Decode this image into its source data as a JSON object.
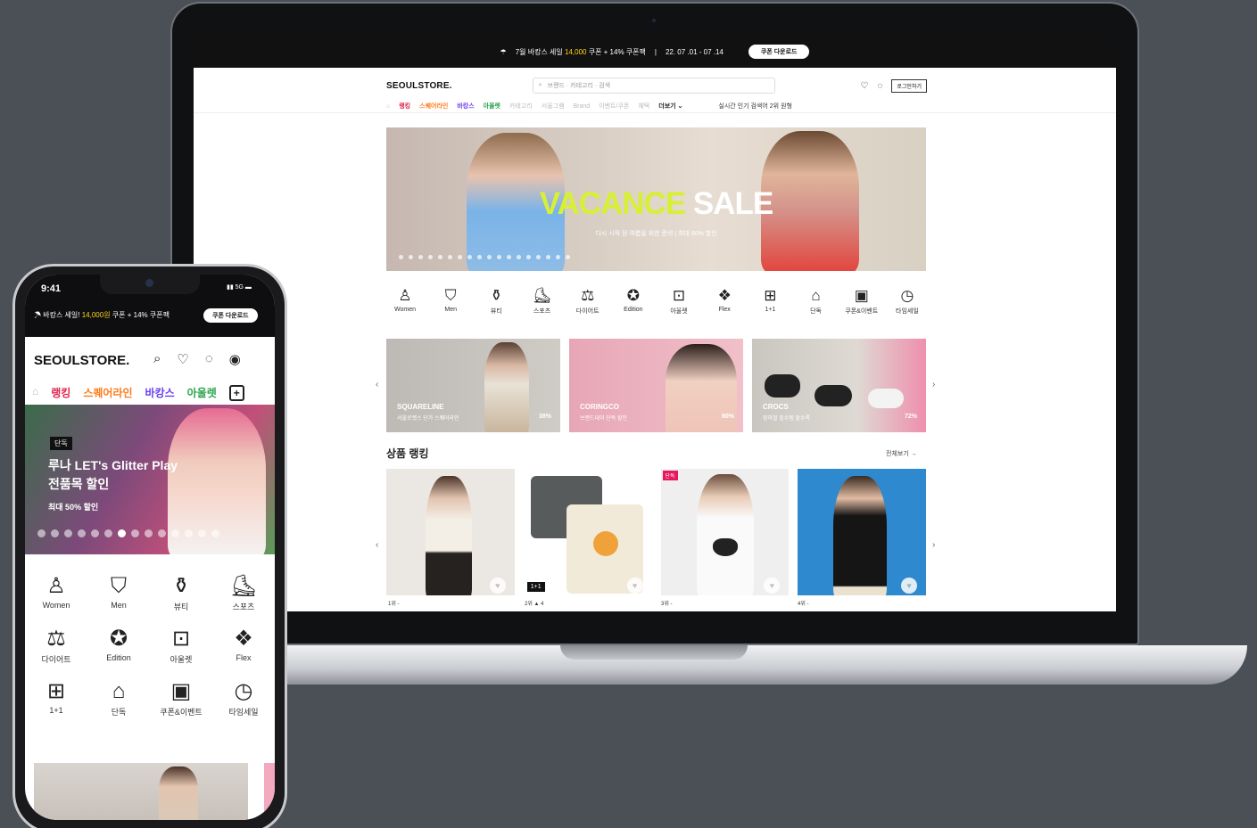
{
  "desktop": {
    "promo": {
      "text_a": "7월 바캉스 세일",
      "amount": "14,000",
      "text_b": "쿠폰 + 14% 쿠폰팩",
      "date": "22. 07 .01 - 07 .14",
      "button": "쿠폰 다운로드"
    },
    "header": {
      "logo": "SEOULSTORE.",
      "search_placeholder": "브랜드 · 카테고리 · 검색",
      "login": "로그인하기"
    },
    "nav": {
      "items": [
        "랭킹",
        "스퀘어라인",
        "바캉스",
        "아울렛",
        "카테고리",
        "서울그램",
        "Brand",
        "이벤트/쿠폰",
        "혜택"
      ],
      "more": "더보기 ⌄",
      "realtime": "실시간 인기 검색어 2위 원형",
      "colors": [
        "#e0224d",
        "#ff7b1c",
        "#6a3df0",
        "#27a34b"
      ]
    },
    "banner": {
      "title_a": "VACANCE",
      "title_b": "SALE",
      "subtitle": "다시 시작 된 여름을 위한 준비 | 최대 80% 할인"
    },
    "categories": [
      {
        "label": "Women",
        "icon": "dress-icon"
      },
      {
        "label": "Men",
        "icon": "jacket-icon"
      },
      {
        "label": "뷰티",
        "icon": "cosmetics-icon"
      },
      {
        "label": "스포츠",
        "icon": "sneaker-icon"
      },
      {
        "label": "다이어트",
        "icon": "scale-icon"
      },
      {
        "label": "Edition",
        "icon": "badge-percent-icon"
      },
      {
        "label": "아울렛",
        "icon": "bag-icon"
      },
      {
        "label": "Flex",
        "icon": "flex-icon"
      },
      {
        "label": "1+1",
        "icon": "plus-box-icon"
      },
      {
        "label": "단독",
        "icon": "tag-icon"
      },
      {
        "label": "쿠폰&이벤트",
        "icon": "coupon-icon"
      },
      {
        "label": "타임세일",
        "icon": "clock-icon"
      }
    ],
    "brands": [
      {
        "name": "SQUARELINE",
        "sub": "서울로켓스 단가 스퀘어라인",
        "pct": "38%"
      },
      {
        "name": "CORINGCO",
        "sub": "브랜드데이 단독 할인",
        "pct": "80%"
      },
      {
        "name": "CROCS",
        "sub": "장마철 필수템 할수록",
        "pct": "72%"
      }
    ],
    "ranking": {
      "title": "상품 랭킹",
      "more": "전체보기 →",
      "items": [
        {
          "rank": "1위  -",
          "tag": "",
          "badge": ""
        },
        {
          "rank": "2위  ▲ 4",
          "tag": "",
          "badge": "1+1"
        },
        {
          "rank": "3위  -",
          "tag": "단독",
          "badge": ""
        },
        {
          "rank": "4위  -",
          "tag": "",
          "badge": ""
        }
      ]
    }
  },
  "mobile": {
    "status": {
      "time": "9:41",
      "signal": "▮▮ 5G ▬"
    },
    "promo": {
      "text_a": "바캉스 세일!",
      "amount": "14,000원",
      "text_b": "쿠폰 + 14% 쿠폰팩",
      "button": "쿠폰 다운로드"
    },
    "header": {
      "logo": "SEOULSTORE."
    },
    "nav": {
      "items": [
        "랭킹",
        "스퀘어라인",
        "바캉스",
        "아울렛"
      ]
    },
    "banner": {
      "tag": "단독",
      "line1": "루나 LET's Glitter Play",
      "line2": "전품목 할인",
      "line3": "최대 50% 할인"
    },
    "categories": [
      {
        "label": "Women"
      },
      {
        "label": "Men"
      },
      {
        "label": "뷰티"
      },
      {
        "label": "스포츠"
      },
      {
        "label": "다이어트"
      },
      {
        "label": "Edition"
      },
      {
        "label": "아울렛"
      },
      {
        "label": "Flex"
      },
      {
        "label": "1+1"
      },
      {
        "label": "단독"
      },
      {
        "label": "쿠폰&이벤트"
      },
      {
        "label": "타임세일"
      }
    ]
  }
}
